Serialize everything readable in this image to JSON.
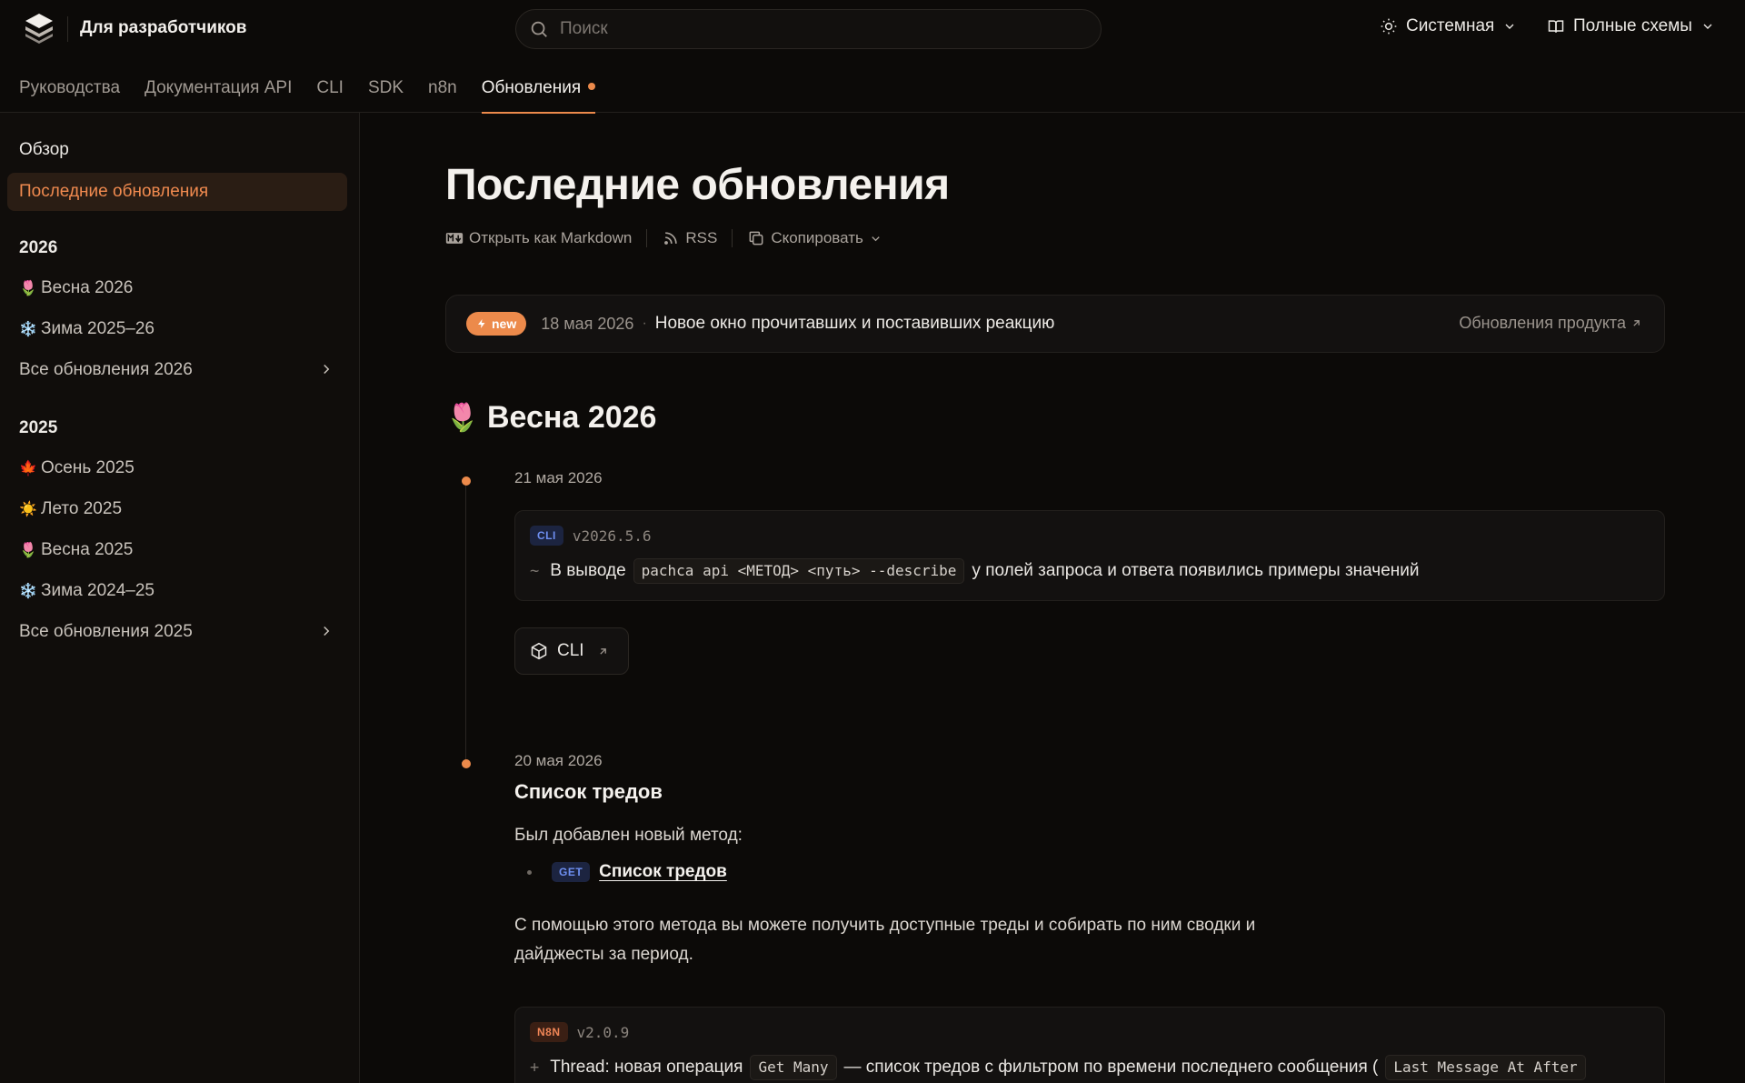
{
  "header": {
    "brand": "Для разработчиков",
    "search_placeholder": "Поиск",
    "theme_label": "Системная",
    "schemas_label": "Полные схемы"
  },
  "nav": {
    "items": [
      "Руководства",
      "Документация API",
      "CLI",
      "SDK",
      "n8n",
      "Обновления"
    ],
    "active": "Обновления"
  },
  "sidebar": {
    "overview": "Обзор",
    "latest": "Последние обновления",
    "year_2026": "2026",
    "items_2026": [
      {
        "emoji": "🌷",
        "label": "Весна 2026"
      },
      {
        "emoji": "❄️",
        "label": "Зима 2025–26"
      }
    ],
    "all_2026": "Все обновления 2026",
    "year_2025": "2025",
    "items_2025": [
      {
        "emoji": "🍁",
        "label": "Осень 2025"
      },
      {
        "emoji": "☀️",
        "label": "Лето 2025"
      },
      {
        "emoji": "🌷",
        "label": "Весна 2025"
      },
      {
        "emoji": "❄️",
        "label": "Зима 2024–25"
      }
    ],
    "all_2025": "Все обновления 2025"
  },
  "main": {
    "title": "Последние обновления",
    "actions": {
      "markdown": "Открыть как Markdown",
      "rss": "RSS",
      "copy": "Скопировать"
    },
    "banner": {
      "badge": "new",
      "date": "18 мая 2026",
      "sep": "·",
      "text": "Новое окно прочитавших и поставивших реакцию",
      "link": "Обновления продукта"
    },
    "section": {
      "emoji": "🌷",
      "title": "Весна 2026"
    },
    "entry1": {
      "date": "21 мая 2026",
      "badge": "CLI",
      "version": "v2026.5.6",
      "symbol": "~",
      "text_before": "В выводе",
      "code": "pachca api <МЕТОД> <путь> --describe",
      "text_after": "у полей запроса и ответа появились примеры значений",
      "button": "CLI"
    },
    "entry2": {
      "date": "20 мая 2026",
      "title": "Список тредов",
      "intro": "Был добавлен новый метод:",
      "method_badge": "GET",
      "method_link": "Список тредов",
      "desc_line1": "С помощью этого метода вы можете получить доступные треды и собирать по ним сводки и",
      "desc_line2": "дайджесты за период.",
      "badge": "N8N",
      "version": "v2.0.9",
      "symbol": "+",
      "text_before": "Thread: новая операция",
      "code1": "Get Many",
      "text_mid": "— список тредов с фильтром по времени последнего сообщения (",
      "code2": "Last Message At After"
    }
  },
  "colors": {
    "accent": "#ec8a4b",
    "background": "#0c0a08",
    "sidebar_active_bg": "#2a1d14",
    "badge_blue": "#6e8ff0"
  },
  "icons": {
    "logo": "layers-logo-icon",
    "search": "search-icon",
    "theme": "sun-icon",
    "schemas": "book-open-icon",
    "chevron": "chevron-down-icon",
    "markdown": "markdown-icon",
    "rss": "rss-icon",
    "copy": "copy-icon",
    "bolt": "bolt-icon",
    "external": "arrow-up-right-icon",
    "package": "package-icon"
  }
}
